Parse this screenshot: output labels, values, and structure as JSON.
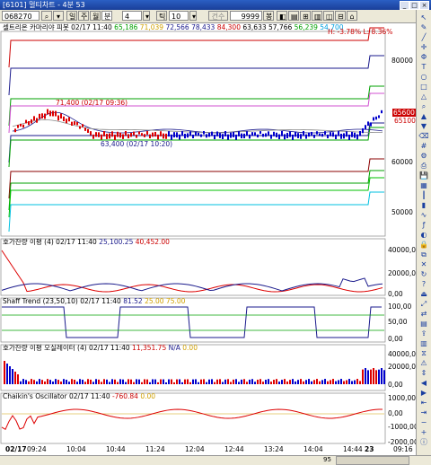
{
  "window": {
    "title": "[6101] 멀티차트 - 4분 53",
    "controls": [
      "_",
      "□",
      "×"
    ]
  },
  "toolbar": {
    "code": "068270",
    "period_buttons": [
      "일",
      "주",
      "월",
      "분",
      "4"
    ],
    "tick_label": "틱",
    "tick_value": "10",
    "count_label": "건수",
    "count_value": "9999",
    "unit_label": "봉"
  },
  "main_chart": {
    "legend_name": "셀트리온",
    "legend_rest": " 카마리야 피봇  02/17 11:40",
    "legend_values": [
      {
        "text": "65,186",
        "color": "#00a000"
      },
      {
        "text": "71,039",
        "color": "#d0a000"
      },
      {
        "text": "72,566",
        "color": "#1a1a8c"
      },
      {
        "text": "78,433",
        "color": "#1a1a8c"
      },
      {
        "text": "84,300",
        "color": "#cc0000"
      },
      {
        "text": "63,633",
        "color": "#000000"
      },
      {
        "text": "57,766",
        "color": "#000000"
      },
      {
        "text": "56,239",
        "color": "#00a000"
      },
      {
        "text": "54,700",
        "color": "#00a0e0"
      }
    ],
    "hi_lo": "H: -3.78%  L: 8.36%",
    "high_annotation": "71,400 (02/17 09:36)",
    "low_annotation": "63,400 (02/17 10:20)",
    "price_labels": [
      "80000",
      "60000",
      "50000"
    ],
    "price_tag_red": "65600",
    "price_tag_dark": "65100"
  },
  "indicators": [
    {
      "name": "호가잔량 이평",
      "params": "(4)",
      "time": "02/17 11:40",
      "values": [
        {
          "text": "25,100.25",
          "color": "#1a1a8c"
        },
        {
          "text": "40,452.00",
          "color": "#cc0000"
        }
      ],
      "axis": [
        "40000,00",
        "20000,00",
        "0,00"
      ]
    },
    {
      "name": "Shaff Trend",
      "params": "(23,50,10)",
      "time": "02/17 11:40",
      "values": [
        {
          "text": "81.52",
          "color": "#1a1a8c"
        },
        {
          "text": "25.00",
          "color": "#d0a000"
        },
        {
          "text": "75.00",
          "color": "#d0a000"
        }
      ],
      "axis": [
        "100,00",
        "50,00",
        "0,00"
      ]
    },
    {
      "name": "호가잔량 이평 오실레이터",
      "params": "(4)",
      "time": "02/17 11:40",
      "values": [
        {
          "text": "11,351.75",
          "color": "#cc0000"
        },
        {
          "text": "N/A",
          "color": "#1a1a8c"
        },
        {
          "text": "0.00",
          "color": "#d0a000"
        }
      ],
      "axis": [
        "40000,00",
        "20000,00",
        "0,00"
      ]
    },
    {
      "name": "Chaikin's Oscillator",
      "params": "",
      "time": "02/17 11:40",
      "values": [
        {
          "text": "-760.84",
          "color": "#cc0000"
        },
        {
          "text": "0.00",
          "color": "#d0a000"
        }
      ],
      "axis": [
        "1000,00",
        "0,00",
        "-1000,00",
        "-2000,00"
      ]
    }
  ],
  "time_axis": [
    "02/17",
    "09:24",
    "10:04",
    "10:44",
    "11:24",
    "12:04",
    "12:44",
    "13:24",
    "14:04",
    "14:44",
    "23",
    "09:16"
  ],
  "status": {
    "zoom": "95"
  },
  "sidebar_icons": [
    "cursor-icon",
    "pencil-icon",
    "line-icon",
    "cross-icon",
    "fibonacci-icon",
    "text-icon",
    "circle-icon",
    "square-icon",
    "triangle-icon",
    "zoom-icon",
    "arrow-up-icon",
    "arrow-down-icon",
    "eraser-icon",
    "grid-icon",
    "settings-icon",
    "print-icon",
    "save-icon",
    "chart-type-icon",
    "candle-icon",
    "bar-icon",
    "line-chart-icon",
    "indicator-icon",
    "color-icon",
    "lock-icon",
    "copy-icon",
    "delete-icon",
    "refresh-icon",
    "help-icon",
    "exit-icon",
    "expand-icon",
    "compare-icon",
    "template-icon",
    "export-icon",
    "layout-icon",
    "filter-icon",
    "alert-icon",
    "scroll-icon",
    "back-icon",
    "forward-icon",
    "home-icon",
    "end-icon",
    "minus-icon",
    "plus-icon",
    "info-icon"
  ]
}
